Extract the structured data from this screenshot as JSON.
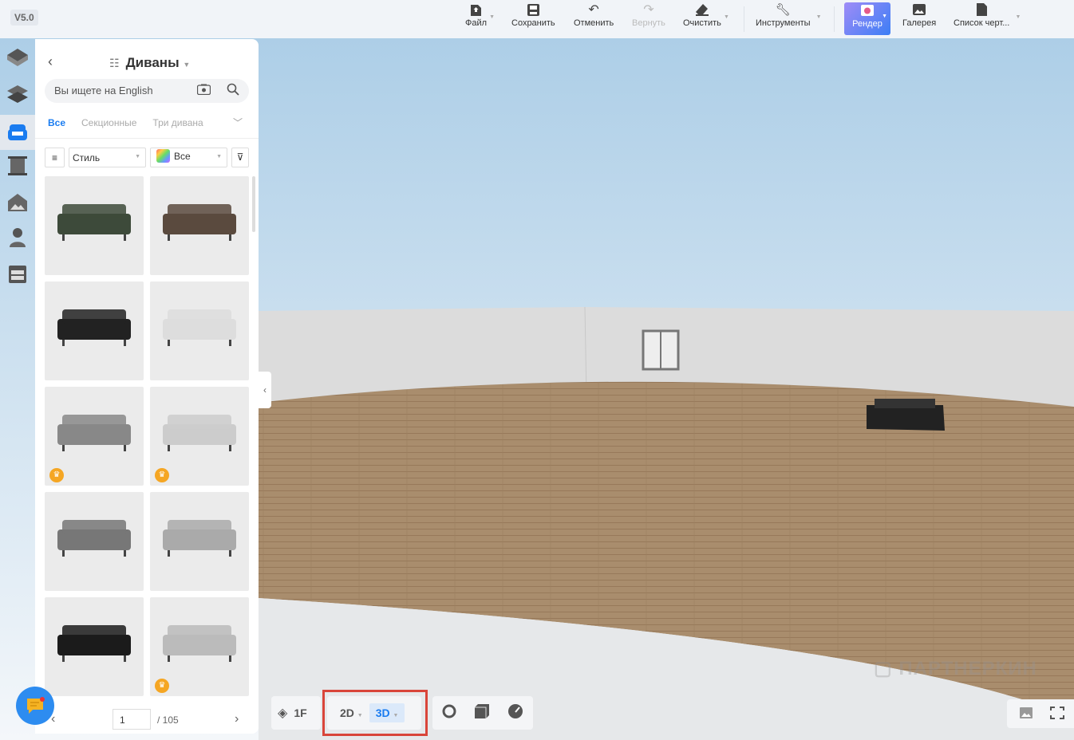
{
  "version": "V5.0",
  "toolbar": {
    "file": "Файл",
    "save": "Сохранить",
    "undo": "Отменить",
    "redo": "Вернуть",
    "clear": "Очистить",
    "tools": "Инструменты",
    "render": "Рендер",
    "gallery": "Галерея",
    "drawings": "Список черт..."
  },
  "panel": {
    "title": "Диваны",
    "search_placeholder": "Вы ищете на English",
    "tabs": [
      "Все",
      "Секционные",
      "Три дивана"
    ],
    "style_filter": "Стиль",
    "color_filter": "Все",
    "products": [
      {
        "premium": false
      },
      {
        "premium": false
      },
      {
        "premium": false
      },
      {
        "premium": false
      },
      {
        "premium": true
      },
      {
        "premium": true
      },
      {
        "premium": false
      },
      {
        "premium": false
      },
      {
        "premium": false
      },
      {
        "premium": true
      }
    ],
    "page": "1",
    "total_pages": "/ 105"
  },
  "bottom": {
    "floor": "1F",
    "view2d": "2D",
    "view3d": "3D"
  },
  "watermark": "ПАРТНЕРКИН",
  "colors": {
    "accent": "#1a7cf0",
    "highlight": "#d9453a",
    "floor": "#a88c6c"
  }
}
